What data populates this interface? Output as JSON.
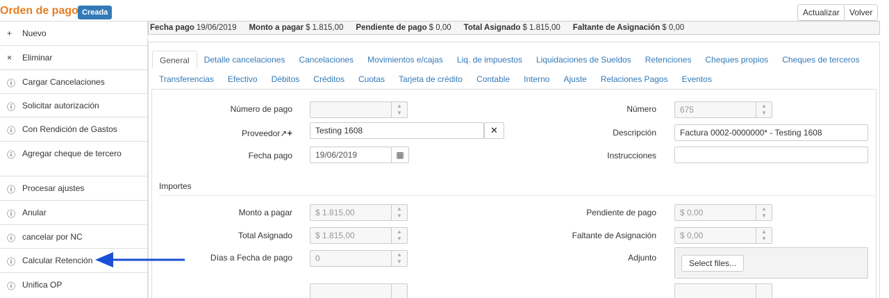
{
  "header": {
    "title": "Orden de pago",
    "status_badge": "Creada",
    "refresh_label": "Actualizar",
    "back_label": "Volver"
  },
  "sidebar": {
    "items": [
      {
        "icon": "+",
        "label": "Nuevo"
      },
      {
        "icon": "×",
        "label": "Eliminar"
      },
      {
        "icon": "ⓘ",
        "label": "Cargar Cancelaciones"
      },
      {
        "icon": "ⓘ",
        "label": "Solicitar autorización"
      },
      {
        "icon": "ⓘ",
        "label": "Con Rendición de Gastos"
      },
      {
        "icon": "ⓘ",
        "label": "Agregar cheque de tercero"
      },
      {
        "icon": "ⓘ",
        "label": "Procesar ajustes"
      },
      {
        "icon": "ⓘ",
        "label": "Anular"
      },
      {
        "icon": "ⓘ",
        "label": "cancelar por NC"
      },
      {
        "icon": "ⓘ",
        "label": "Calcular Retención"
      },
      {
        "icon": "ⓘ",
        "label": "Unifica OP"
      }
    ]
  },
  "summary": {
    "fecha_pago_label": "Fecha pago",
    "fecha_pago_value": "19/06/2019",
    "monto_label": "Monto a pagar",
    "monto_value": "$ 1.815,00",
    "pendiente_label": "Pendiente de pago",
    "pendiente_value": "$ 0,00",
    "asignado_label": "Total Asignado",
    "asignado_value": "$ 1.815,00",
    "faltante_label": "Faltante de Asignación",
    "faltante_value": "$ 0,00"
  },
  "tabs": {
    "row1": [
      "General",
      "Detalle cancelaciones",
      "Cancelaciones",
      "Movimientos e/cajas",
      "Liq. de impuestos",
      "Liquidaciones de Sueldos",
      "Retenciones",
      "Cheques propios",
      "Cheques de terceros"
    ],
    "row2": [
      "Transferencias",
      "Efectivo",
      "Débitos",
      "Créditos",
      "Cuotas",
      "Tarjeta de crédito",
      "Contable",
      "Interno",
      "Ajuste",
      "Relaciones Pagos",
      "Eventos"
    ]
  },
  "form": {
    "numero_pago_label": "Número de pago",
    "numero_pago_value": "",
    "proveedor_label": "Proveedor",
    "proveedor_value": "Testing 1608",
    "fecha_pago_label": "Fecha pago",
    "fecha_pago_value": "19/06/2019",
    "numero_label": "Número",
    "numero_value": "675",
    "descripcion_label": "Descripción",
    "descripcion_value": "Factura 0002-0000000* - Testing 1608",
    "instrucciones_label": "Instrucciones",
    "instrucciones_value": ""
  },
  "importes": {
    "section_label": "Importes",
    "monto_label": "Monto a pagar",
    "monto_value": "$ 1.815,00",
    "total_asignado_label": "Total Asignado",
    "total_asignado_value": "$ 1.815,00",
    "dias_label": "Días a Fecha de pago",
    "dias_value": "0",
    "pendiente_label": "Pendiente de pago",
    "pendiente_value": "$ 0,00",
    "faltante_label": "Faltante de Asignación",
    "faltante_value": "$ 0,00",
    "adjunto_label": "Adjunto",
    "select_files_label": "Select files..."
  },
  "colors": {
    "title": "#e67e22",
    "badge": "#337ab7",
    "link": "#337ab7",
    "arrow": "#1a4fd6"
  }
}
